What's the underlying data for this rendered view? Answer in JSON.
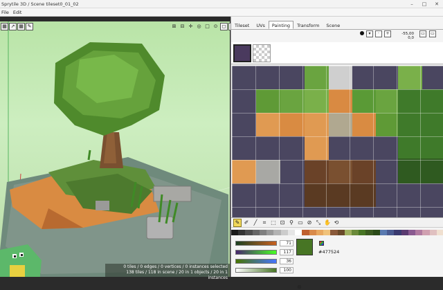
{
  "window": {
    "title": "Sprytile 3D / Scene tileset0_01_02",
    "controls": [
      "–",
      "□",
      "✕"
    ]
  },
  "menu": [
    "File",
    "Edit"
  ],
  "viewport": {
    "toolbar_left": [
      "▦",
      "↗",
      "▦",
      "✎"
    ],
    "toolbar_right": [
      "⊞",
      "⊟",
      "✛",
      "◎",
      "□",
      "⊙",
      "◻",
      "☐"
    ],
    "status_line1": "0 tiles / 0 edges / 0 vertices / 0 instances selected",
    "status_line2": "138 tiles / 118 in scene / 20 in 1 objects / 20 in 1 instances"
  },
  "panel": {
    "tabs": [
      "Tileset",
      "UVs",
      "Painting",
      "Transform",
      "Scene"
    ],
    "active_tab": "Painting",
    "coord_top": "-55,00",
    "coord_bottom": "0,0",
    "tools": [
      "✎",
      "✐",
      "╱",
      "⌗",
      "⬚",
      "⊡",
      "⚲",
      "▭",
      "⊘",
      "⤡",
      "✋",
      "⟲"
    ],
    "palette": [
      "#1a1a1a",
      "#333333",
      "#4d4d4d",
      "#666666",
      "#808080",
      "#999999",
      "#b3b3b3",
      "#cccccc",
      "#e6e6e6",
      "#ffffff",
      "#c06030",
      "#d98a4a",
      "#e8a860",
      "#f0c27a",
      "#8a5a3a",
      "#6a4a2a",
      "#a0b060",
      "#6a8a3a",
      "#477524",
      "#3a5a20",
      "#2a4a18",
      "#5a7ab0",
      "#4a5a90",
      "#3a3a70",
      "#5a3a70",
      "#8a5a90",
      "#b07aa0",
      "#d0a0b0",
      "#e0c0c0",
      "#f0e0d0"
    ],
    "sliders": [
      {
        "value": "71",
        "gradient": "linear-gradient(to right, #1a4020, #c86020)"
      },
      {
        "value": "117",
        "gradient": "linear-gradient(to right, #47246e, #47ff24)"
      },
      {
        "value": "36",
        "gradient": "linear-gradient(to right, #477500, #4775ff)"
      },
      {
        "value": "100",
        "gradient": "linear-gradient(to right, #ffffff, #477524)"
      }
    ],
    "color_hex": "#477524",
    "color_swatch": "#477524",
    "eyedropper_icon": "⊗"
  }
}
